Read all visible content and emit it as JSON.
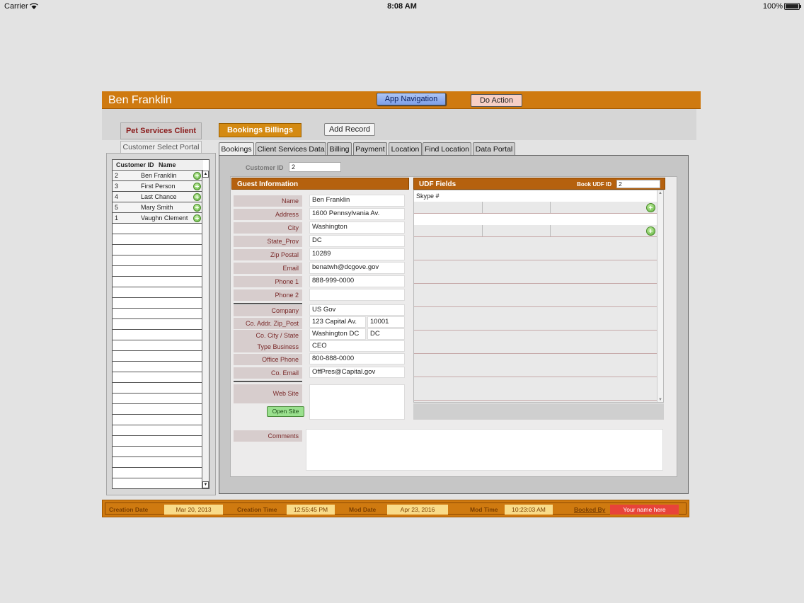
{
  "status_bar": {
    "carrier": "Carrier",
    "time": "8:08 AM",
    "battery": "100%"
  },
  "header": {
    "title": "Ben Franklin",
    "nav_button": "App Navigation",
    "action_button": "Do Action"
  },
  "left": {
    "tab_label": "Pet Services Client",
    "portal_label": "Customer Select Portal",
    "columns": [
      "Customer ID",
      "Name"
    ],
    "rows": [
      {
        "id": "2",
        "name": "Ben Franklin"
      },
      {
        "id": "3",
        "name": "First Person"
      },
      {
        "id": "4",
        "name": "Last Chance"
      },
      {
        "id": "5",
        "name": "Mary Smith"
      },
      {
        "id": "1",
        "name": "Vaughn Clement"
      }
    ]
  },
  "toolbar": {
    "bookings_button": "Bookings Billings",
    "add_button": "Add Record"
  },
  "tabs": [
    "Bookings",
    "Client Services Data",
    "Billing",
    "Payment",
    "Location",
    "Find Location",
    "Data Portal"
  ],
  "active_tab": "Bookings",
  "customer": {
    "id_label": "Customer ID",
    "id_value": "2"
  },
  "guest": {
    "title": "Guest Information",
    "fields": [
      {
        "label": "Name",
        "value": "Ben Franklin"
      },
      {
        "label": "Address",
        "value": "1600 Pennsylvania Av."
      },
      {
        "label": "City",
        "value": "Washington"
      },
      {
        "label": "State_Prov",
        "value": "DC"
      },
      {
        "label": "Zip Postal",
        "value": "10289"
      },
      {
        "label": "Email",
        "value": "benatwh@dcgove.gov"
      },
      {
        "label": "Phone 1",
        "value": "888-999-0000"
      },
      {
        "label": "Phone 2",
        "value": ""
      }
    ],
    "company": {
      "label": "Company",
      "value": "US Gov"
    },
    "co_addr": {
      "label": "Co. Addr. Zip_Post",
      "value": "123 Capital Av.",
      "zip": "10001"
    },
    "co_city": {
      "label": "Co.  City / State",
      "value": "Washington DC",
      "state": "DC"
    },
    "type_business": {
      "label": "Type Business",
      "value": "CEO"
    },
    "office_phone": {
      "label": "Office Phone",
      "value": "800-888-0000"
    },
    "co_email": {
      "label": "Co. Email",
      "value": "OffPres@Capital.gov"
    },
    "web_site": {
      "label": "Web Site",
      "value": ""
    },
    "open_site_button": "Open Site",
    "comments": {
      "label": "Comments",
      "value": ""
    }
  },
  "udf": {
    "title": "UDF Fields",
    "id_label": "Book UDF ID",
    "id_value": "2",
    "rows": [
      {
        "text": "Skype #"
      },
      {
        "text": ""
      }
    ]
  },
  "footer": {
    "creation_date_label": "Creation Date",
    "creation_date": "Mar 20, 2013",
    "creation_time_label": "Creation Time",
    "creation_time": "12:55:45 PM",
    "mod_date_label": "Mod Date",
    "mod_date": "Apr 23, 2016",
    "mod_time_label": "Mod Time",
    "mod_time": "10:23:03 AM",
    "booked_by_label": "Booked By",
    "booked_by": "Your name here"
  },
  "colors": {
    "header": "#cf7a10",
    "section_head": "#b5610e",
    "label_bg": "#d7cdcd",
    "label_text": "#7a2a2a",
    "nav_button": "#7c9ee8",
    "booked_by": "#e8433a"
  }
}
